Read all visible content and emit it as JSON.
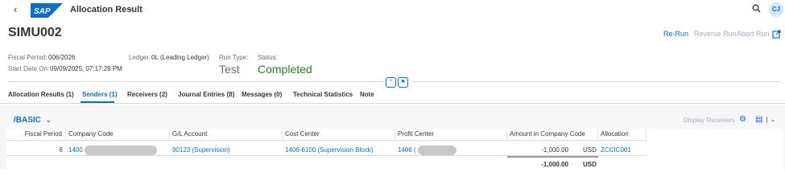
{
  "shell": {
    "back_icon": "back-arrow-icon",
    "logo_text": "SAP",
    "app_title": "Allocation Result",
    "avatar_initials": "CJ",
    "colors": {
      "accent": "#0a6ed1",
      "logo": "#0a6ed1",
      "success": "#2b7d2b"
    }
  },
  "header": {
    "title": "SIMU002",
    "actions": {
      "rerun": "Re-Run",
      "reverse": "Reverse Run",
      "abort": "Abort Run"
    },
    "fields": {
      "fiscal_period_label": "Fiscal Period:",
      "fiscal_period_value": "006/2026",
      "start_date_label": "Start Date On:",
      "start_date_value": "09/09/2025, 07:17:28 PM",
      "ledger_label": "Ledger:",
      "ledger_value": "0L (Leading Ledger)",
      "run_type_label": "Run Type:",
      "run_type_value": "Test",
      "status_label": "Status:",
      "status_value": "Completed"
    }
  },
  "tabs": [
    {
      "label": "Allocation Results (1)"
    },
    {
      "label": "Senders (1)",
      "active": true
    },
    {
      "label": "Receivers (2)"
    },
    {
      "label": "Journal Entries (8)"
    },
    {
      "label": "Messages (0)"
    },
    {
      "label": "Technical Statistics"
    },
    {
      "label": "Note"
    }
  ],
  "table_toolbar": {
    "variant": "/BASIC",
    "display_receivers": "Display Receivers"
  },
  "table": {
    "columns": [
      "Fiscal Period",
      "Company Code",
      "G/L Account",
      "Cost Center",
      "Profit Center",
      "Amount in Company Code Cu...",
      "Allocation Cycle"
    ],
    "rows": [
      {
        "fiscal_period": "6",
        "company_code": "1400",
        "gl_account": "90123 (Supervision)",
        "cost_center": "1406-6100 (Supervision Block)",
        "profit_center": "1406 (",
        "amount": "-1,000.00",
        "currency": "USD",
        "cycle": "ZCCIC001"
      }
    ],
    "total": {
      "amount": "-1,000.00",
      "currency": "USD"
    }
  }
}
